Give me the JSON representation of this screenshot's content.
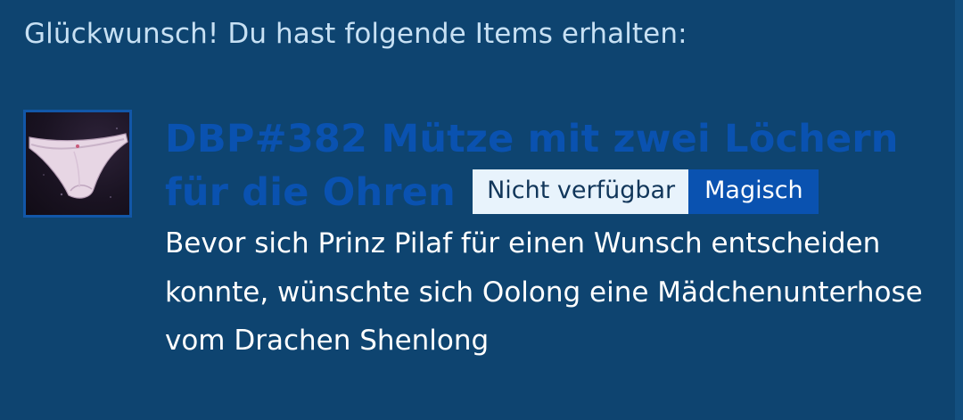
{
  "heading": "Glückwunsch! Du hast folgende Items erhalten:",
  "item": {
    "image_icon": "panties-image-icon",
    "title": "DBP#382 Mütze mit zwei Löchern für die Ohren",
    "availability_badge": "Nicht verfügbar",
    "rarity_badge": "Magisch",
    "description": "Bevor sich Prinz Pilaf für einen Wunsch entscheiden konnte, wünschte sich Oolong eine Mädchenunterhose vom Drachen Shenlong"
  },
  "colors": {
    "background": "#0e4470",
    "heading_text": "#c7e0f3",
    "title_text": "#0a52b0",
    "badge_light_bg": "#e8f3fc",
    "badge_rarity_bg": "#0a52b0",
    "description_text": "#ffffff",
    "image_border": "#1257a8"
  }
}
